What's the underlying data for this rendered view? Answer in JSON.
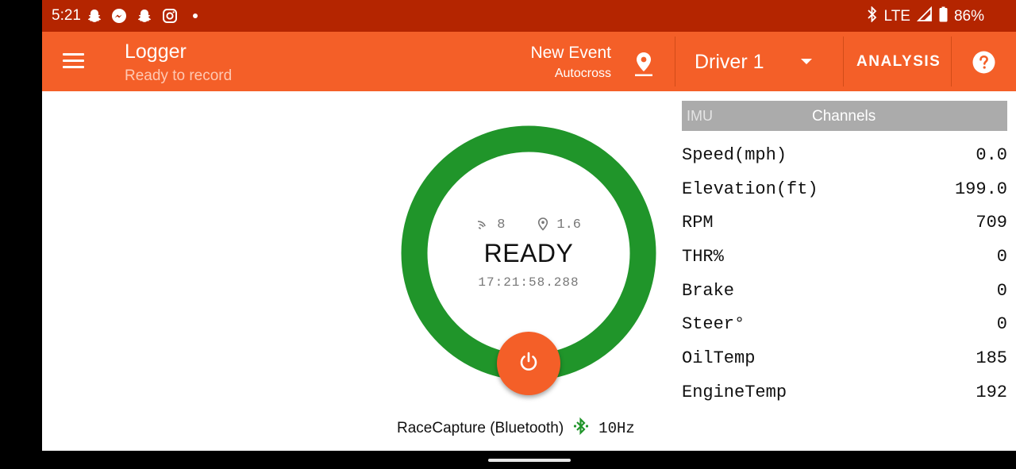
{
  "status_bar": {
    "time": "5:21",
    "notification_icons": [
      "snapchat-icon",
      "messenger-icon",
      "snapchat-icon",
      "instagram-icon",
      "more-dot-icon"
    ],
    "network": "LTE",
    "battery": "86%"
  },
  "app_bar": {
    "title": "Logger",
    "subtitle": "Ready to record",
    "event_name": "New Event",
    "event_type": "Autocross",
    "driver": "Driver 1",
    "analysis_label": "ANALYSIS",
    "colors": {
      "bar": "#f45f28",
      "status": "#b42500"
    }
  },
  "gauge": {
    "satellites": "8",
    "gps_quality": "1.6",
    "state": "READY",
    "timestamp": "17:21:58.288",
    "ring_color": "#20952a"
  },
  "connection": {
    "device": "RaceCapture (Bluetooth)",
    "rate": "10Hz"
  },
  "tabs": {
    "imu": "IMU",
    "channels": "Channels"
  },
  "channels": [
    {
      "name": "Speed(mph)",
      "value": "0.0"
    },
    {
      "name": "Elevation(ft)",
      "value": "199.0"
    },
    {
      "name": "RPM",
      "value": "709"
    },
    {
      "name": "THR%",
      "value": "0"
    },
    {
      "name": "Brake",
      "value": "0"
    },
    {
      "name": "Steer°",
      "value": "0"
    },
    {
      "name": "OilTemp",
      "value": "185"
    },
    {
      "name": "EngineTemp",
      "value": "192"
    }
  ]
}
